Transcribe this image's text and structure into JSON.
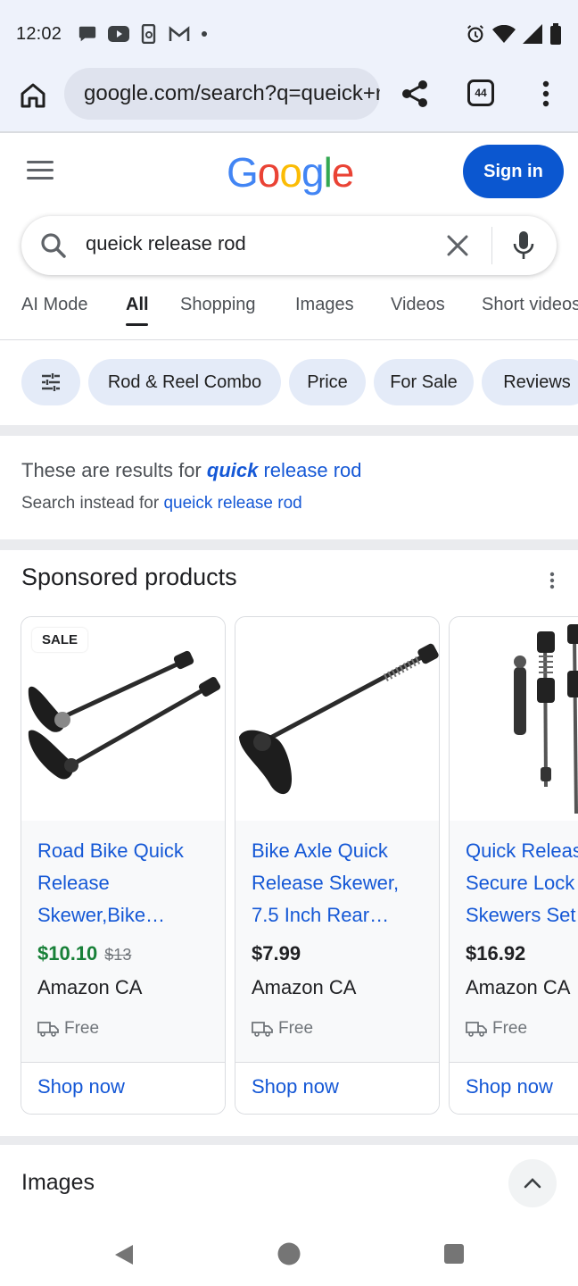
{
  "status_bar": {
    "time": "12:02",
    "left_icons": [
      "chat-bubble-icon",
      "youtube-icon",
      "phone-sync-icon",
      "gmail-icon",
      "dot-icon"
    ],
    "right_icons": [
      "alarm-icon",
      "wifi-icon",
      "signal-icon",
      "battery-icon"
    ]
  },
  "browser": {
    "url": "google.com/search?q=queick+release+rod",
    "tab_count": "44",
    "icons": [
      "home-icon",
      "site-settings-icon",
      "share-icon",
      "tabs-icon",
      "more-vert-icon"
    ]
  },
  "header": {
    "logo": [
      "G",
      "o",
      "o",
      "g",
      "l",
      "e"
    ],
    "logo_colors": [
      "#4285f4",
      "#ea4335",
      "#fbbc05",
      "#4285f4",
      "#34a853",
      "#ea4335"
    ],
    "sign_in_label": "Sign in"
  },
  "search": {
    "query": "queick release rod"
  },
  "tabs": {
    "items": [
      "AI Mode",
      "All",
      "Shopping",
      "Images",
      "Videos",
      "Short videos"
    ],
    "active": "All"
  },
  "chips": [
    "Rod & Reel Combo",
    "Price",
    "For Sale",
    "Reviews"
  ],
  "spelling": {
    "prefix": "These are results for ",
    "corrected_bold": "quick",
    "corrected_rest": " release rod",
    "instead_prefix": "Search instead for ",
    "instead_link": "queick release rod"
  },
  "sponsored": {
    "title": "Sponsored products",
    "products": [
      {
        "badge": "SALE",
        "title": "Road Bike Quick Release Skewer,Bike…",
        "price": "$10.10",
        "original_price": "$13",
        "seller": "Amazon CA",
        "shipping": "Free",
        "cta": "Shop now"
      },
      {
        "title": "Bike Axle Quick Release Skewer, 7.5 Inch Rear…",
        "price": "$7.99",
        "seller": "Amazon CA",
        "shipping": "Free",
        "cta": "Shop now"
      },
      {
        "title": "Quick Release Secure Lock Skewers Set",
        "price": "$16.92",
        "seller": "Amazon CA",
        "shipping": "Free",
        "cta": "Shop now"
      }
    ]
  },
  "images_section": {
    "title": "Images"
  },
  "colors": {
    "accent_blue": "#0b57d0",
    "link_blue": "#1558d6",
    "sale_green": "#188038",
    "chip_bg": "#e4ebf8"
  }
}
